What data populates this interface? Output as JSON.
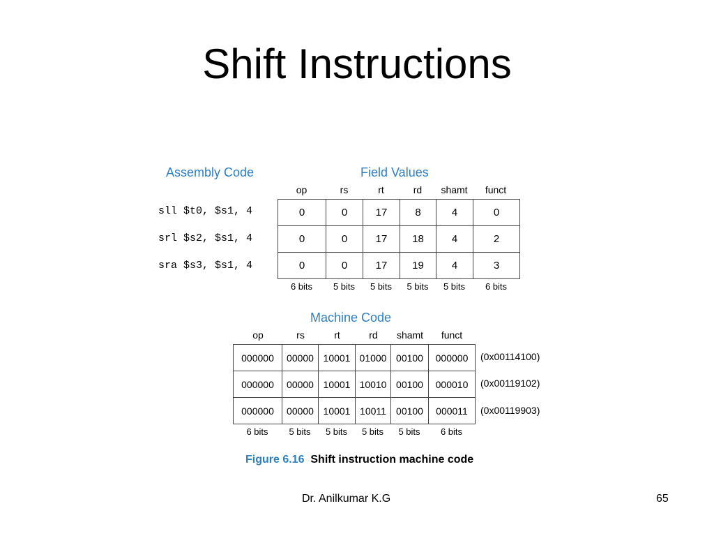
{
  "slide": {
    "title": "Shift Instructions",
    "footer_author": "Dr. Anilkumar K.G",
    "page_number": "65"
  },
  "figure": {
    "assembly_heading": "Assembly Code",
    "field_values_heading": "Field Values",
    "machine_code_heading": "Machine Code",
    "columns": [
      "op",
      "rs",
      "rt",
      "rd",
      "shamt",
      "funct"
    ],
    "assembly": [
      "sll $t0, $s1, 4",
      "srl $s2, $s1, 4",
      "sra $s3, $s1, 4"
    ],
    "field_values": [
      [
        "0",
        "0",
        "17",
        "8",
        "4",
        "0"
      ],
      [
        "0",
        "0",
        "17",
        "18",
        "4",
        "2"
      ],
      [
        "0",
        "0",
        "17",
        "19",
        "4",
        "3"
      ]
    ],
    "machine_code": [
      [
        "000000",
        "00000",
        "10001",
        "01000",
        "00100",
        "000000"
      ],
      [
        "000000",
        "00000",
        "10001",
        "10010",
        "00100",
        "000010"
      ],
      [
        "000000",
        "00000",
        "10001",
        "10011",
        "00100",
        "000011"
      ]
    ],
    "hex": [
      "(0x00114100)",
      "(0x00119102)",
      "(0x00119903)"
    ],
    "bit_widths": [
      "6 bits",
      "5 bits",
      "5 bits",
      "5 bits",
      "5 bits",
      "6 bits"
    ],
    "caption_number": "Figure 6.16",
    "caption_text": "Shift instruction machine code",
    "accent_color": "#2e7fc0"
  }
}
